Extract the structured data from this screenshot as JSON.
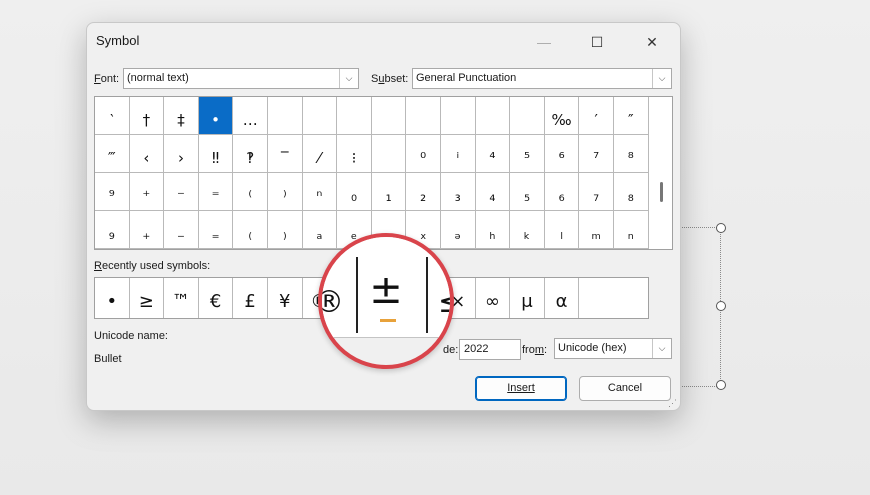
{
  "window": {
    "title": "Symbol",
    "minimize_glyph": "—",
    "maximize_glyph": "☐",
    "close_glyph": "✕"
  },
  "font": {
    "label_prefix": "F",
    "label_rest": "ont:",
    "value": "(normal text)"
  },
  "subset": {
    "label_prefix": "S",
    "label_accel": "u",
    "label_rest": "bset:",
    "value": "General Punctuation"
  },
  "symbol_grid": {
    "rows": [
      [
        "‵",
        "†",
        "‡",
        "•",
        "…",
        "",
        "",
        "",
        "",
        "",
        "",
        "",
        "",
        "‰",
        "′",
        "″"
      ],
      [
        "‴",
        "‹",
        "›",
        "‼",
        "‽",
        "‾",
        "⁄",
        "⁝",
        "",
        "⁰",
        "ⁱ",
        "⁴",
        "⁵",
        "⁶",
        "⁷",
        "⁸"
      ],
      [
        "⁹",
        "⁺",
        "⁻",
        "⁼",
        "⁽",
        "⁾",
        "ⁿ",
        "₀",
        "₁",
        "₂",
        "₃",
        "₄",
        "₅",
        "₆",
        "₇",
        "₈"
      ],
      [
        "₉",
        "₊",
        "₋",
        "₌",
        "₍",
        "₎",
        "ₐ",
        "ₑ",
        "ₒ",
        "ₓ",
        "ₔ",
        "ₕ",
        "ₖ",
        "ₗ",
        "ₘ",
        "ₙ"
      ]
    ],
    "selected": "•"
  },
  "recent": {
    "label_accel": "R",
    "label_rest": "ecently used symbols:",
    "symbols": [
      "•",
      "≥",
      "™",
      "€",
      "£",
      "¥",
      "®",
      "±",
      "≤",
      "÷",
      "×",
      "∞",
      "μ",
      "α"
    ]
  },
  "unicode": {
    "name_label": "Unicode name:",
    "name_value": "Bullet",
    "code_label_visible": "de:",
    "code_value": "2022",
    "from_label_prefix": "fro",
    "from_label_accel": "m",
    "from_label_rest": ":",
    "from_value": "Unicode (hex)"
  },
  "buttons": {
    "insert": "Insert",
    "cancel": "Cancel"
  },
  "magnifier": {
    "glyph": "±",
    "partial_left": "®",
    "partial_right": "≤"
  },
  "arrow_glyph": "⌵"
}
